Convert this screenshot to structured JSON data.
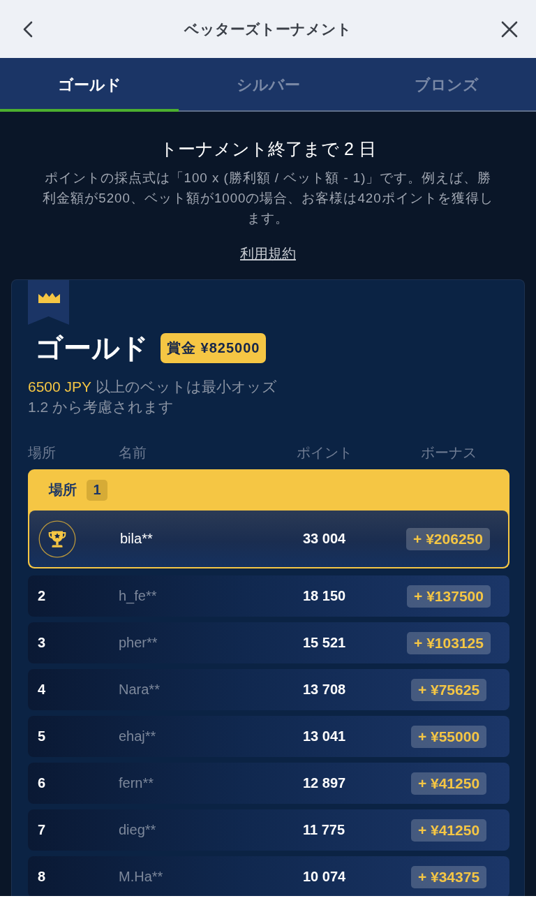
{
  "header": {
    "title": "ベッターズトーナメント"
  },
  "tabs": [
    {
      "label": "ゴールド",
      "selected": true
    },
    {
      "label": "シルバー",
      "selected": false
    },
    {
      "label": "ブロンズ",
      "selected": false
    }
  ],
  "intro": {
    "title": "トーナメント終了まで 2 日",
    "description": "ポイントの採点式は「100 x (勝利額 / ベット額 - 1)」です。例えば、勝利金額が5200、ベット額が1000の場合、お客様は420ポイントを獲得します。",
    "link": "利用規約"
  },
  "tier": {
    "name": "ゴールド",
    "prize": "賞金 ¥825000",
    "min_bet": {
      "amount": "6500 JPY",
      "text": "以上のベットは最小オッズ 1.2 から考慮されます"
    },
    "columns": [
      "場所",
      "名前",
      "ポイント",
      "ボーナス"
    ],
    "rows": [
      {
        "kind": "winner",
        "label": "場所",
        "place": "1",
        "name": "bila**",
        "points": "33 004",
        "bonus": "+ ¥206250"
      },
      {
        "kind": "standard",
        "rank": "2",
        "name": "h_fe**",
        "points": "18 150",
        "bonus": "+ ¥137500"
      },
      {
        "kind": "standard",
        "rank": "3",
        "name": "pher**",
        "points": "15 521",
        "bonus": "+ ¥103125"
      },
      {
        "kind": "standard",
        "rank": "4",
        "name": "Nara**",
        "points": "13 708",
        "bonus": "+ ¥75625"
      },
      {
        "kind": "standard",
        "rank": "5",
        "name": "ehaj**",
        "points": "13 041",
        "bonus": "+ ¥55000"
      },
      {
        "kind": "standard",
        "rank": "6",
        "name": "fern**",
        "points": "12 897",
        "bonus": "+ ¥41250"
      },
      {
        "kind": "standard",
        "rank": "7",
        "name": "dieg**",
        "points": "11 775",
        "bonus": "+ ¥41250"
      },
      {
        "kind": "standard",
        "rank": "8",
        "name": "M.Ha**",
        "points": "10 074",
        "bonus": "+ ¥34375"
      }
    ]
  }
}
